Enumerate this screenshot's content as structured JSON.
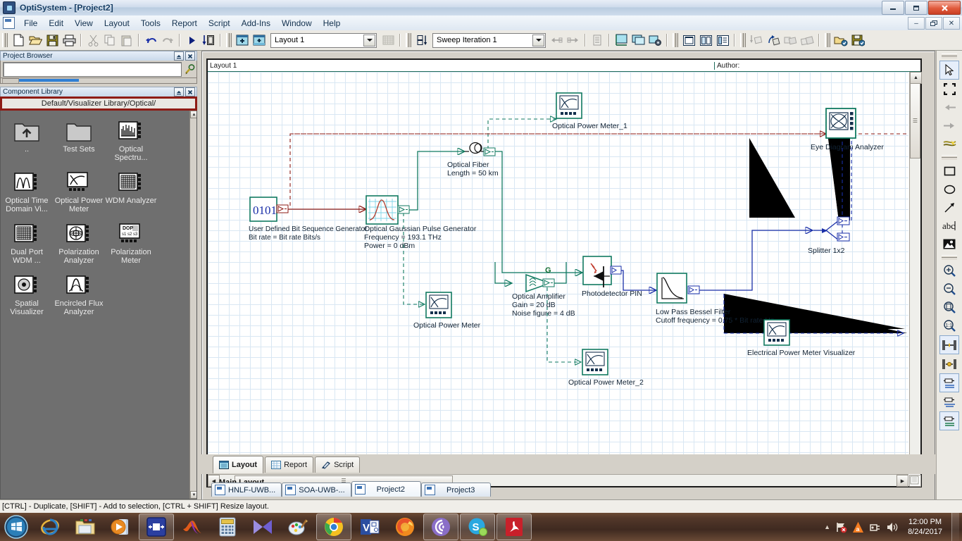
{
  "window": {
    "title": "OptiSystem - [Project2]",
    "app_icon": "optisystem-icon",
    "minimize": "–",
    "maximize": "❐",
    "close": "✕",
    "mdi_minimize": "–",
    "mdi_restore": "❐",
    "mdi_close": "✕"
  },
  "menu": {
    "items": [
      "File",
      "Edit",
      "View",
      "Layout",
      "Tools",
      "Report",
      "Script",
      "Add-Ins",
      "Window",
      "Help"
    ]
  },
  "toolbar": {
    "buttons": [
      {
        "name": "new-icon",
        "title": "New"
      },
      {
        "name": "open-icon",
        "title": "Open"
      },
      {
        "name": "save-icon",
        "title": "Save"
      },
      {
        "name": "print-icon",
        "title": "Print"
      },
      {
        "name": "cut-icon",
        "title": "Cut"
      },
      {
        "name": "copy-icon",
        "title": "Copy"
      },
      {
        "name": "paste-icon",
        "title": "Paste"
      },
      {
        "name": "undo-icon",
        "title": "Undo"
      },
      {
        "name": "redo-icon",
        "title": "Redo"
      },
      {
        "name": "run-icon",
        "title": "Calculate"
      },
      {
        "name": "run-to-icon",
        "title": "Run"
      }
    ],
    "layout_combo": {
      "value": "Layout 1",
      "placeholder": "Layout 1"
    },
    "sweep_combo": {
      "value": "Sweep Iteration 1",
      "placeholder": "Sweep Iteration 1"
    }
  },
  "project_browser": {
    "title": "Project Browser",
    "search_value": "",
    "search_placeholder": ""
  },
  "component_library": {
    "title": "Component Library",
    "path": "Default/Visualizer Library/Optical/",
    "items": [
      {
        "label": "..",
        "icon": "folder-up-icon"
      },
      {
        "label": "Test Sets",
        "icon": "folder-icon"
      },
      {
        "label": "Optical Spectru...",
        "icon": "optical-spectrum-analyzer-icon"
      },
      {
        "label": "Optical Time Domain Vi...",
        "icon": "optical-time-domain-visualizer-icon"
      },
      {
        "label": "Optical Power Meter",
        "icon": "optical-power-meter-icon"
      },
      {
        "label": "WDM Analyzer",
        "icon": "wdm-analyzer-icon"
      },
      {
        "label": "Dual Port WDM ...",
        "icon": "dual-port-wdm-icon"
      },
      {
        "label": "Polarization Analyzer",
        "icon": "polarization-analyzer-icon"
      },
      {
        "label": "Polarization Meter",
        "icon": "polarization-meter-icon"
      },
      {
        "label": "Spatial Visualizer",
        "icon": "spatial-visualizer-icon"
      },
      {
        "label": "Encircled Flux Analyzer",
        "icon": "encircled-flux-analyzer-icon"
      }
    ]
  },
  "document": {
    "layout_name": "Layout 1",
    "author_label": "Author:",
    "main_layout_tab": "Main Layout"
  },
  "schematic": {
    "components": [
      {
        "id": "bitseq",
        "name": "User Defined Bit Sequence Generator",
        "params": [
          "Bit rate = Bit rate  Bits/s"
        ]
      },
      {
        "id": "gauss",
        "name": "Optical Gaussian Pulse Generator",
        "params": [
          "Frequency = 193.1  THz",
          "Power = 0  dBm"
        ]
      },
      {
        "id": "fiber",
        "name": "Optical Fiber",
        "params": [
          "Length = 50  km"
        ]
      },
      {
        "id": "opm1",
        "name": "Optical Power Meter_1",
        "params": []
      },
      {
        "id": "opm",
        "name": "Optical Power Meter",
        "params": []
      },
      {
        "id": "opm2",
        "name": "Optical Power Meter_2",
        "params": []
      },
      {
        "id": "amp",
        "name": "Optical Amplifier",
        "params": [
          "Gain = 20  dB",
          "Noise figure = 4  dB"
        ]
      },
      {
        "id": "pin",
        "name": "Photodetector PIN",
        "params": []
      },
      {
        "id": "bessel",
        "name": "Low Pass Bessel Filter",
        "params": [
          "Cutoff frequency = 0.75 * Bit rate  Hz"
        ]
      },
      {
        "id": "splitter",
        "name": "Splitter 1x2",
        "params": []
      },
      {
        "id": "eye",
        "name": "Eye Diagram Analyzer",
        "params": []
      },
      {
        "id": "epm",
        "name": "Electrical Power Meter Visualizer",
        "params": []
      }
    ],
    "amplifier_gain_symbol": "G"
  },
  "view_tabs": [
    {
      "label": "Layout",
      "icon": "layout-icon",
      "active": true
    },
    {
      "label": "Report",
      "icon": "report-icon",
      "active": false
    },
    {
      "label": "Script",
      "icon": "script-icon",
      "active": false
    }
  ],
  "project_tabs": [
    {
      "label": "HNLF-UWB...",
      "active": false
    },
    {
      "label": "SOA-UWB-...",
      "active": false
    },
    {
      "label": "Project2",
      "active": true
    },
    {
      "label": "Project3",
      "active": false
    }
  ],
  "right_tools": [
    {
      "name": "select-arrow-tool",
      "selected": true
    },
    {
      "name": "fit-selection-tool",
      "selected": false
    },
    {
      "name": "connector-left-tool",
      "selected": false
    },
    {
      "name": "connector-right-tool",
      "selected": false
    },
    {
      "name": "highlight-connections-tool",
      "selected": false
    },
    {
      "name": "rectangle-tool",
      "selected": false
    },
    {
      "name": "ellipse-tool",
      "selected": false
    },
    {
      "name": "line-tool",
      "selected": false
    },
    {
      "name": "text-tool",
      "selected": false
    },
    {
      "name": "image-tool",
      "selected": false
    },
    {
      "name": "zoom-in-tool",
      "selected": false
    },
    {
      "name": "zoom-out-tool",
      "selected": false
    },
    {
      "name": "zoom-page-tool",
      "selected": false
    },
    {
      "name": "zoom-actual-tool",
      "selected": false
    },
    {
      "name": "align-horizontal-tool",
      "selected": false
    },
    {
      "name": "distribute-horizontal-tool",
      "selected": false
    },
    {
      "name": "align-top-tool",
      "selected": false
    },
    {
      "name": "align-middle-tool",
      "selected": false
    },
    {
      "name": "align-bottom-tool",
      "selected": false
    }
  ],
  "statusbar": {
    "text": "[CTRL] - Duplicate, [SHIFT] - Add to selection, [CTRL + SHIFT] Resize layout."
  },
  "taskbar": {
    "start": "start-orb",
    "items": [
      {
        "name": "internet-explorer-icon",
        "open": false
      },
      {
        "name": "file-explorer-icon",
        "open": false
      },
      {
        "name": "media-player-icon",
        "open": false
      },
      {
        "name": "optisystem-icon",
        "open": true
      },
      {
        "name": "matlab-icon",
        "open": false
      },
      {
        "name": "calculator-icon",
        "open": false
      },
      {
        "name": "kmplayer-icon",
        "open": false
      },
      {
        "name": "paint-icon",
        "open": false
      },
      {
        "name": "chrome-icon",
        "open": true
      },
      {
        "name": "visio-icon",
        "open": false
      },
      {
        "name": "firefox-icon",
        "open": false
      },
      {
        "name": "bittorrent-icon",
        "open": true
      },
      {
        "name": "skype-icon",
        "open": true
      },
      {
        "name": "adobe-reader-icon",
        "open": true
      }
    ],
    "tray": {
      "expand": "▲",
      "icons": [
        "network-error-icon",
        "avast-icon",
        "safely-remove-icon",
        "volume-icon"
      ],
      "time": "12:00 PM",
      "date": "8/24/2017"
    }
  },
  "colors": {
    "accent_red": "#8e1b15",
    "optical_green": "#117a60",
    "electrical_blue": "#1a2fa8",
    "signal_red": "#8e1b15",
    "canvas_grid": "#d9e7f3"
  }
}
